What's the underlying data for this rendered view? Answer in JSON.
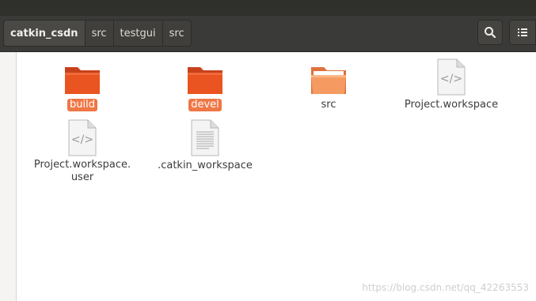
{
  "breadcrumbs": [
    "catkin_csdn",
    "src",
    "testgui",
    "src"
  ],
  "toolbar": {
    "search_icon": "search-icon",
    "view_icon": "list-view-icon"
  },
  "files": [
    {
      "name": "build",
      "type": "folder",
      "selected": true
    },
    {
      "name": "devel",
      "type": "folder",
      "selected": true
    },
    {
      "name": "src",
      "type": "folder-open",
      "selected": false
    },
    {
      "name": "Project.workspace",
      "type": "code-file",
      "selected": false
    },
    {
      "name": "Project.workspace.user",
      "type": "code-file",
      "selected": false
    },
    {
      "name": ".catkin_workspace",
      "type": "text-file",
      "selected": false
    }
  ],
  "watermark": "https://blog.csdn.net/qq_42263553",
  "colors": {
    "accent": "#e95420",
    "selection": "#f07746",
    "toolbar": "#3a3a38"
  }
}
